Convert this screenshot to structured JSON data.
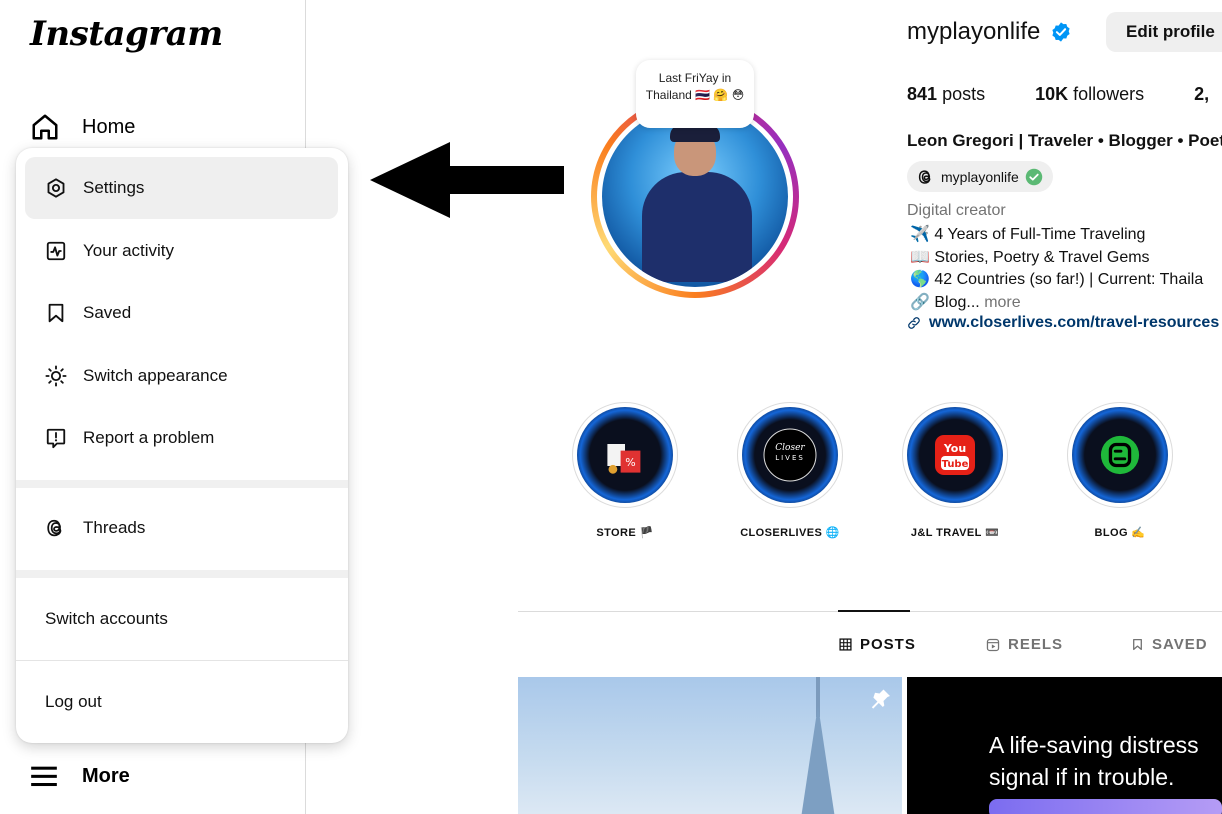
{
  "sidebar": {
    "logo": "Instagram",
    "home_label": "Home",
    "more_label": "More"
  },
  "menu": {
    "items": [
      {
        "label": "Settings",
        "icon": "settings-icon"
      },
      {
        "label": "Your activity",
        "icon": "activity-icon"
      },
      {
        "label": "Saved",
        "icon": "bookmark-icon"
      },
      {
        "label": "Switch appearance",
        "icon": "sun-icon"
      },
      {
        "label": "Report a problem",
        "icon": "report-icon"
      }
    ],
    "threads_label": "Threads",
    "switch_accounts_label": "Switch accounts",
    "logout_label": "Log out"
  },
  "profile": {
    "username": "myplayonlife",
    "edit_profile_label": "Edit profile",
    "note": "Last FriYay in Thailand 🇹🇭 🤗 😳",
    "posts_count": "841",
    "posts_label": "posts",
    "followers_count": "10K",
    "followers_label": "followers",
    "following_count": "2,",
    "full_name": "Leon Gregori | Traveler • Blogger • Poet",
    "threads_handle": "myplayonlife",
    "category": "Digital creator",
    "bio_lines": [
      "✈️ 4 Years of Full-Time Traveling",
      "📖 Stories, Poetry & Travel Gems",
      "🌎 42 Countries (so far!) | Current: Thaila",
      "🔗 Blog..."
    ],
    "bio_more": "more",
    "link": "www.closerlives.com/travel-resources"
  },
  "highlights": [
    {
      "label": "STORE 🏴"
    },
    {
      "label": "CLOSERLIVES 🌐"
    },
    {
      "label": "J&L TRAVEL 📼"
    },
    {
      "label": "BLOG ✍️"
    }
  ],
  "tabs": [
    {
      "label": "POSTS",
      "icon": "grid-icon",
      "active": true
    },
    {
      "label": "REELS",
      "icon": "reels-icon",
      "active": false
    },
    {
      "label": "SAVED",
      "icon": "bookmark-icon",
      "active": false
    }
  ],
  "posts": {
    "post2_text_line1": "A life-saving distress",
    "post2_text_line2": "signal if in trouble."
  },
  "colors": {
    "accent_blue": "#0095f6",
    "link_blue": "#00376b",
    "muted_gray": "#737373"
  }
}
